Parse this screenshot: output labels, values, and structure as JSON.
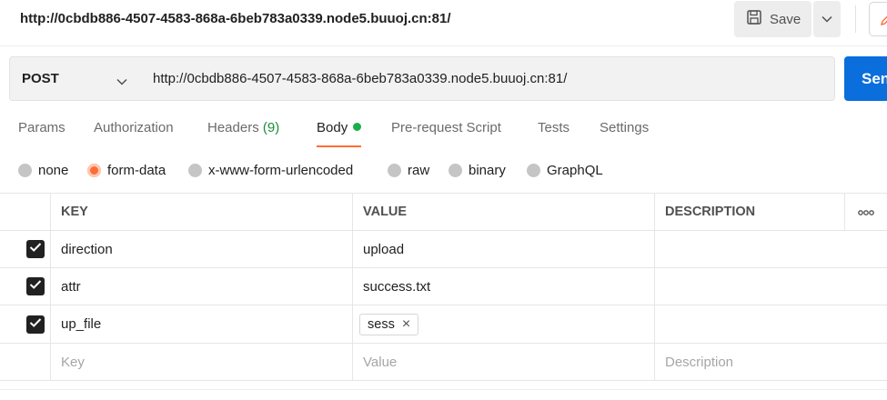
{
  "request": {
    "title": "http://0cbdb886-4507-4583-868a-6beb783a0339.node5.buuoj.cn:81/",
    "save_label": "Save",
    "method": "POST",
    "url": "http://0cbdb886-4507-4583-868a-6beb783a0339.node5.buuoj.cn:81/",
    "send_label": "Send"
  },
  "tabs": [
    {
      "label": "Params"
    },
    {
      "label": "Authorization"
    },
    {
      "label": "Headers",
      "count": "(9)"
    },
    {
      "label": "Body",
      "active": true
    },
    {
      "label": "Pre-request Script"
    },
    {
      "label": "Tests"
    },
    {
      "label": "Settings"
    }
  ],
  "body_types": [
    {
      "label": "none"
    },
    {
      "label": "form-data",
      "selected": true
    },
    {
      "label": "x-www-form-urlencoded"
    },
    {
      "label": "raw"
    },
    {
      "label": "binary"
    },
    {
      "label": "GraphQL"
    }
  ],
  "table": {
    "headers": {
      "key": "KEY",
      "value": "VALUE",
      "description": "DESCRIPTION",
      "more": "ooo"
    },
    "rows": [
      {
        "checked": true,
        "key": "direction",
        "value": "upload",
        "description": ""
      },
      {
        "checked": true,
        "key": "attr",
        "value": "success.txt",
        "description": ""
      },
      {
        "checked": true,
        "key": "up_file",
        "file": "sess",
        "remove": "×",
        "description": ""
      }
    ],
    "placeholders": {
      "key": "Key",
      "value": "Value",
      "description": "Description"
    }
  },
  "colors": {
    "accent": "#ff6c37",
    "send": "#0a6edc",
    "body_dot": "#1aae4b",
    "headers_count": "#1a8c3a"
  },
  "icons": [
    "save-icon",
    "chevron-down-icon",
    "edit-icon",
    "check-icon",
    "close-icon",
    "more-icon"
  ]
}
